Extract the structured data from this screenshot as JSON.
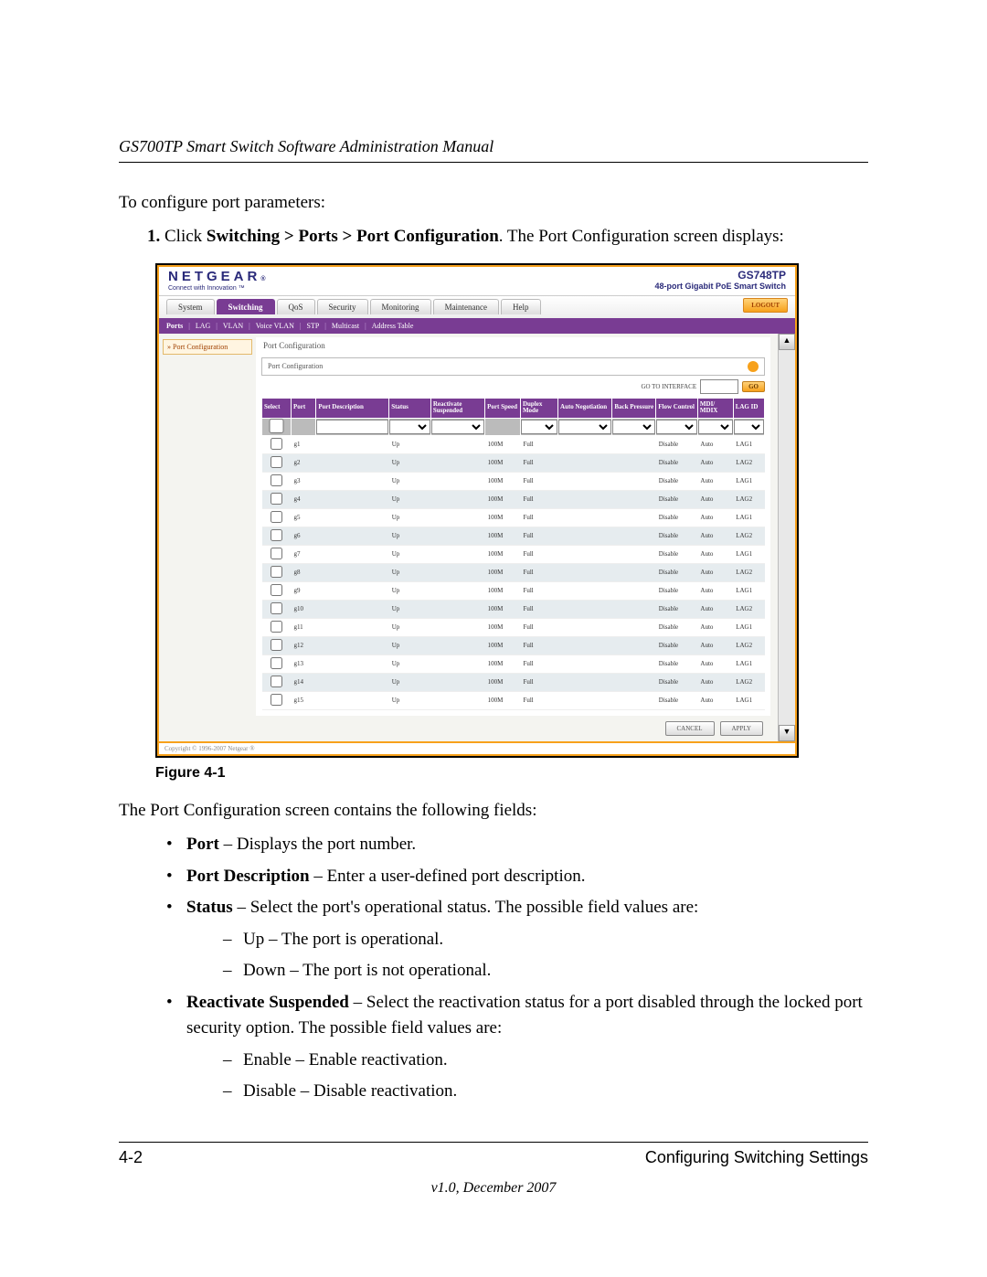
{
  "header": {
    "title": "GS700TP Smart Switch Software Administration Manual"
  },
  "intro": "To configure port parameters:",
  "step": {
    "prefix": "Click ",
    "bold": "Switching > Ports > Port Configuration",
    "suffix": ". The Port Configuration screen displays:"
  },
  "screenshot": {
    "logo_main": "NETGEAR",
    "logo_sup": "®",
    "logo_sub": "Connect with Innovation ™",
    "model": "GS748TP",
    "model_desc": "48-port Gigabit PoE Smart Switch",
    "tabs": [
      "System",
      "Switching",
      "QoS",
      "Security",
      "Monitoring",
      "Maintenance",
      "Help"
    ],
    "active_tab": 1,
    "logout": "LOGOUT",
    "subnav": [
      "Ports",
      "LAG",
      "VLAN",
      "Voice VLAN",
      "STP",
      "Multicast",
      "Address Table"
    ],
    "subnav_active": 0,
    "side_item": "» Port Configuration",
    "panel_title": "Port Configuration",
    "panel_sub": "Port Configuration",
    "goto_label": "GO TO INTERFACE",
    "go_btn": "GO",
    "columns": [
      "Select",
      "Port",
      "Port Description",
      "Status",
      "Reactivate Suspended",
      "Port Speed",
      "Duplex Mode",
      "Auto Negotiation",
      "Back Pressure",
      "Flow Control",
      "MDI/ MDIX",
      "LAG ID"
    ],
    "rows": [
      {
        "port": "g1",
        "status": "Up",
        "speed": "100M",
        "duplex": "Full",
        "flow": "Disable",
        "mdi": "Auto",
        "lag": "LAG1"
      },
      {
        "port": "g2",
        "status": "Up",
        "speed": "100M",
        "duplex": "Full",
        "flow": "Disable",
        "mdi": "Auto",
        "lag": "LAG2"
      },
      {
        "port": "g3",
        "status": "Up",
        "speed": "100M",
        "duplex": "Full",
        "flow": "Disable",
        "mdi": "Auto",
        "lag": "LAG1"
      },
      {
        "port": "g4",
        "status": "Up",
        "speed": "100M",
        "duplex": "Full",
        "flow": "Disable",
        "mdi": "Auto",
        "lag": "LAG2"
      },
      {
        "port": "g5",
        "status": "Up",
        "speed": "100M",
        "duplex": "Full",
        "flow": "Disable",
        "mdi": "Auto",
        "lag": "LAG1"
      },
      {
        "port": "g6",
        "status": "Up",
        "speed": "100M",
        "duplex": "Full",
        "flow": "Disable",
        "mdi": "Auto",
        "lag": "LAG2"
      },
      {
        "port": "g7",
        "status": "Up",
        "speed": "100M",
        "duplex": "Full",
        "flow": "Disable",
        "mdi": "Auto",
        "lag": "LAG1"
      },
      {
        "port": "g8",
        "status": "Up",
        "speed": "100M",
        "duplex": "Full",
        "flow": "Disable",
        "mdi": "Auto",
        "lag": "LAG2"
      },
      {
        "port": "g9",
        "status": "Up",
        "speed": "100M",
        "duplex": "Full",
        "flow": "Disable",
        "mdi": "Auto",
        "lag": "LAG1"
      },
      {
        "port": "g10",
        "status": "Up",
        "speed": "100M",
        "duplex": "Full",
        "flow": "Disable",
        "mdi": "Auto",
        "lag": "LAG2"
      },
      {
        "port": "g11",
        "status": "Up",
        "speed": "100M",
        "duplex": "Full",
        "flow": "Disable",
        "mdi": "Auto",
        "lag": "LAG1"
      },
      {
        "port": "g12",
        "status": "Up",
        "speed": "100M",
        "duplex": "Full",
        "flow": "Disable",
        "mdi": "Auto",
        "lag": "LAG2"
      },
      {
        "port": "g13",
        "status": "Up",
        "speed": "100M",
        "duplex": "Full",
        "flow": "Disable",
        "mdi": "Auto",
        "lag": "LAG1"
      },
      {
        "port": "g14",
        "status": "Up",
        "speed": "100M",
        "duplex": "Full",
        "flow": "Disable",
        "mdi": "Auto",
        "lag": "LAG2"
      },
      {
        "port": "g15",
        "status": "Up",
        "speed": "100M",
        "duplex": "Full",
        "flow": "Disable",
        "mdi": "Auto",
        "lag": "LAG1"
      }
    ],
    "cancel_btn": "CANCEL",
    "apply_btn": "APPLY",
    "copyright": "Copyright © 1996-2007 Netgear ®"
  },
  "figure_caption": "Figure 4-1",
  "after_fig": "The Port Configuration screen contains the following fields:",
  "fields": [
    {
      "term": "Port",
      "desc": " – Displays the port number."
    },
    {
      "term": "Port Description",
      "desc": " – Enter a user-defined port description."
    },
    {
      "term": "Status",
      "desc": " – Select the port's operational status. The possible field values are:",
      "sub": [
        "Up – The port is operational.",
        "Down – The port is not operational."
      ]
    },
    {
      "term": "Reactivate Suspended",
      "desc": " – Select the reactivation status for a port disabled through the locked port security option. The possible field values are:",
      "sub": [
        "Enable – Enable reactivation.",
        "Disable – Disable reactivation."
      ]
    }
  ],
  "footer": {
    "page": "4-2",
    "section": "Configuring Switching Settings",
    "version": "v1.0, December 2007"
  }
}
